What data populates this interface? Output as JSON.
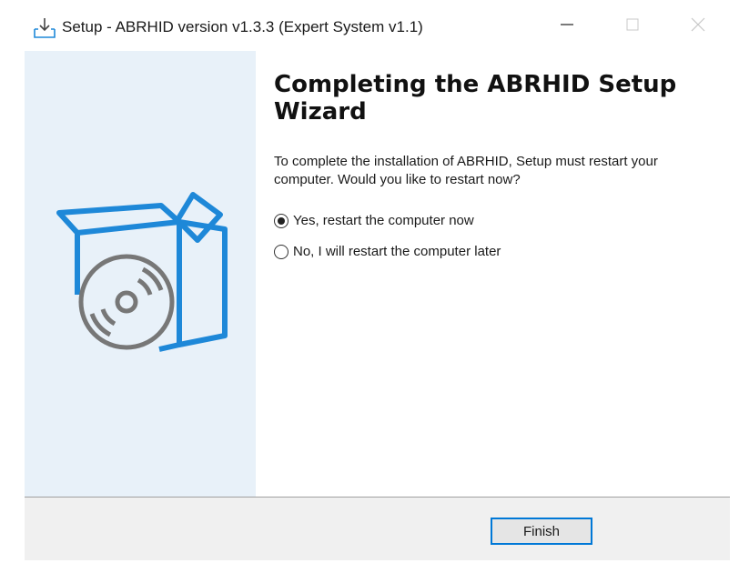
{
  "window": {
    "title": "Setup - ABRHID version v1.3.3 (Expert System v1.1)",
    "icon": "setup-download-icon"
  },
  "title_bar": {
    "minimize_icon": "minimize-icon",
    "maximize_icon": "maximize-icon",
    "close_icon": "close-icon"
  },
  "side_panel": {
    "illustration": "software-box-with-disc",
    "colors": {
      "background": "#e8f1f9",
      "accent": "#1e88d8",
      "disc": "#777777"
    }
  },
  "main": {
    "heading": "Completing the ABRHID Setup Wizard",
    "description": "To complete the installation of ABRHID, Setup must restart your computer. Would you like to restart now?",
    "options": [
      {
        "label": "Yes, restart the computer now",
        "selected": true
      },
      {
        "label": "No, I will restart the computer later",
        "selected": false
      }
    ]
  },
  "footer": {
    "finish_label": "Finish",
    "colors": {
      "button_border": "#0078d7"
    }
  }
}
